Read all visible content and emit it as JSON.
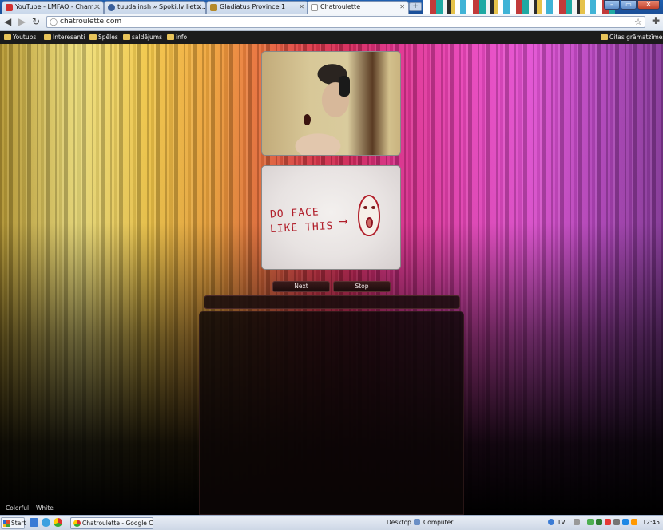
{
  "browser": {
    "tabs": [
      {
        "title": "YouTube - LMFAO - Cham...",
        "favicon": "youtube-icon",
        "color": "#d32f2f"
      },
      {
        "title": "tuudalinsh » Spoki.lv lieto...",
        "favicon": "spoki-icon",
        "color": "#3a5f9a"
      },
      {
        "title": "Gladiatus Province 1",
        "favicon": "gladiatus-icon",
        "color": "#b58a2a"
      },
      {
        "title": "Chatroulette",
        "favicon": "page-icon",
        "color": "#ffffff"
      }
    ],
    "new_tab_label": "+",
    "url": "chatroulette.com",
    "bookmarks": [
      "Youtubs",
      "Interesanti",
      "Spēles",
      "saldējums",
      "info"
    ],
    "other_bookmarks": "Citas grāmatzīmes"
  },
  "page": {
    "video_note": {
      "line1": "DO FACE",
      "line2": "LIKE THIS",
      "arrow": "→"
    },
    "next_label": "Next",
    "stop_label": "Stop",
    "theme_colorful": "Colorful",
    "theme_white": "White"
  },
  "taskbar": {
    "start_label": "Start",
    "task_item": "Chatroulette - Google C...",
    "desktop_label": "Desktop",
    "computer_label": "Computer",
    "lang": "LV",
    "clock": "12:45"
  }
}
